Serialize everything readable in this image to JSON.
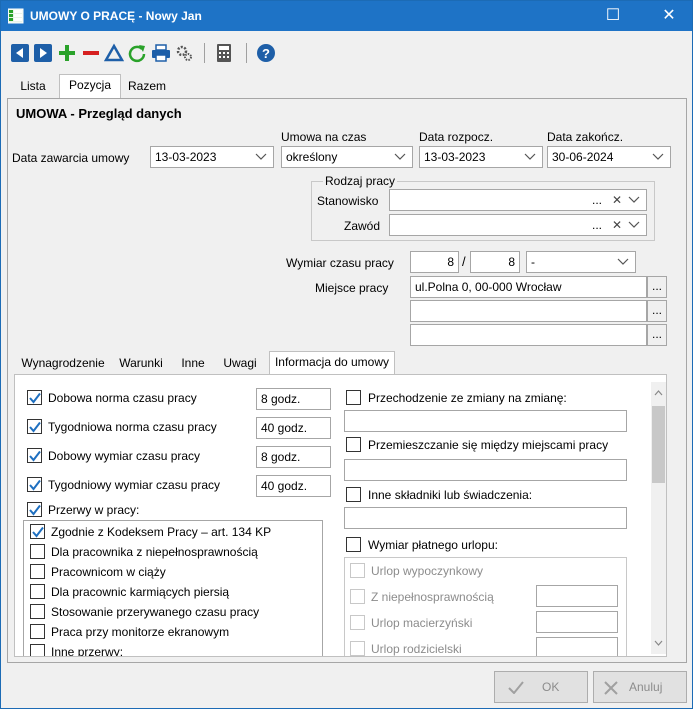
{
  "window": {
    "title": "UMOWY O PRACĘ - Nowy Jan",
    "minimize": "☐",
    "close": "✕"
  },
  "main_tabs": [
    {
      "label": "Lista"
    },
    {
      "label": "Pozycja"
    },
    {
      "label": "Razem"
    }
  ],
  "section_title": "UMOWA - Przegląd danych",
  "form": {
    "data_zawarcia": {
      "label": "Data zawarcia umowy",
      "value": "13-03-2023"
    },
    "umowa_na_czas": {
      "label": "Umowa na czas",
      "value": "określony"
    },
    "data_rozpocz": {
      "label": "Data rozpocz.",
      "value": "13-03-2023"
    },
    "data_zakoncz": {
      "label": "Data zakończ.",
      "value": "30-06-2024"
    },
    "rodzaj_pracy": {
      "label": "Rodzaj pracy"
    },
    "stanowisko": {
      "label": "Stanowisko",
      "value": ""
    },
    "zawod": {
      "label": "Zawód",
      "value": ""
    },
    "dots": "...",
    "clear": "✕",
    "wymiar": {
      "label": "Wymiar czasu pracy",
      "num": "8",
      "slash": "/",
      "den": "8",
      "unit": "-"
    },
    "miejsce": {
      "label": "Miejsce pracy",
      "line1": "ul.Polna 0, 00-000 Wrocław",
      "line2": "",
      "line3": ""
    }
  },
  "sub_tabs": [
    {
      "label": "Wynagrodzenie"
    },
    {
      "label": "Warunki"
    },
    {
      "label": "Inne"
    },
    {
      "label": "Uwagi"
    },
    {
      "label": "Informacja do umowy"
    }
  ],
  "left_checks": [
    {
      "label": "Dobowa norma czasu pracy",
      "checked": true,
      "value": "8 godz."
    },
    {
      "label": "Tygodniowa norma czasu pracy",
      "checked": true,
      "value": "40 godz."
    },
    {
      "label": "Dobowy wymiar czasu pracy",
      "checked": true,
      "value": "8 godz."
    },
    {
      "label": "Tygodniowy wymiar czasu pracy",
      "checked": true,
      "value": "40 godz."
    }
  ],
  "przerwy": {
    "label": "Przerwy w pracy:",
    "checked": true
  },
  "przerwy_items": [
    {
      "label": "Zgodnie z Kodeksem Pracy – art. 134 KP",
      "checked": true
    },
    {
      "label": "Dla pracownika z niepełnosprawnością",
      "checked": false
    },
    {
      "label": "Pracownicom w ciąży",
      "checked": false
    },
    {
      "label": "Dla pracownic karmiących piersią",
      "checked": false
    },
    {
      "label": "Stosowanie przerywanego czasu pracy",
      "checked": false
    },
    {
      "label": "Praca przy monitorze ekranowym",
      "checked": false
    },
    {
      "label": "Inne przerwy:",
      "checked": false
    }
  ],
  "right_checks": [
    {
      "label": "Przechodzenie ze zmiany na zmianę:"
    },
    {
      "label": "Przemieszczanie się między miejscami pracy"
    },
    {
      "label": "Inne składniki lub świadczenia:"
    },
    {
      "label": "Wymiar płatnego urlopu:"
    }
  ],
  "urlop_items": [
    {
      "label": "Urlop wypoczynkowy"
    },
    {
      "label": "Z niepełnosprawnością"
    },
    {
      "label": "Urlop macierzyński"
    },
    {
      "label": "Urlop rodzicielski"
    }
  ],
  "footer": {
    "ok": "OK",
    "cancel": "Anuluj"
  },
  "colors": {
    "titlebar": "#1e73c6",
    "check": "#1e6fc0",
    "green": "#2aa22a",
    "red": "#d62020",
    "blue_icon": "#1e5fa8"
  }
}
